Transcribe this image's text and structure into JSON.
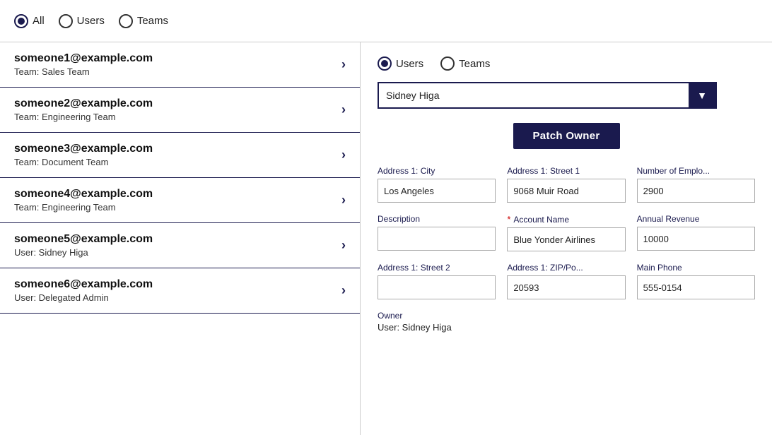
{
  "topBar": {
    "radioOptions": [
      {
        "id": "all",
        "label": "All",
        "checked": true
      },
      {
        "id": "users",
        "label": "Users",
        "checked": false
      },
      {
        "id": "teams",
        "label": "Teams",
        "checked": false
      }
    ]
  },
  "leftPanel": {
    "items": [
      {
        "email": "someone1@example.com",
        "sub": "Team: Sales Team"
      },
      {
        "email": "someone2@example.com",
        "sub": "Team: Engineering Team"
      },
      {
        "email": "someone3@example.com",
        "sub": "Team: Document Team"
      },
      {
        "email": "someone4@example.com",
        "sub": "Team: Engineering Team"
      },
      {
        "email": "someone5@example.com",
        "sub": "User: Sidney Higa"
      },
      {
        "email": "someone6@example.com",
        "sub": "User: Delegated Admin"
      }
    ]
  },
  "rightPanel": {
    "radioOptions": [
      {
        "id": "r-users",
        "label": "Users",
        "checked": true
      },
      {
        "id": "r-teams",
        "label": "Teams",
        "checked": false
      }
    ],
    "dropdown": {
      "value": "Sidney Higa",
      "arrow": "▼"
    },
    "patchOwnerBtn": "Patch Owner",
    "fields": [
      {
        "label": "Address 1: City",
        "value": "Los Angeles",
        "required": false,
        "col": 1
      },
      {
        "label": "Address 1: Street 1",
        "value": "9068 Muir Road",
        "required": false,
        "col": 2
      },
      {
        "label": "Number of Emplo...",
        "value": "2900",
        "required": false,
        "col": 3
      },
      {
        "label": "Description",
        "value": "",
        "required": false,
        "col": 1
      },
      {
        "label": "Account Name",
        "value": "Blue Yonder Airlines",
        "required": true,
        "col": 2
      },
      {
        "label": "Annual Revenue",
        "value": "10000",
        "required": false,
        "col": 3
      },
      {
        "label": "Address 1: Street 2",
        "value": "",
        "required": false,
        "col": 1
      },
      {
        "label": "Address 1: ZIP/Po...",
        "value": "20593",
        "required": false,
        "col": 2
      },
      {
        "label": "Main Phone",
        "value": "555-0154",
        "required": false,
        "col": 3
      }
    ],
    "owner": {
      "label": "Owner",
      "value": "User: Sidney Higa"
    }
  }
}
